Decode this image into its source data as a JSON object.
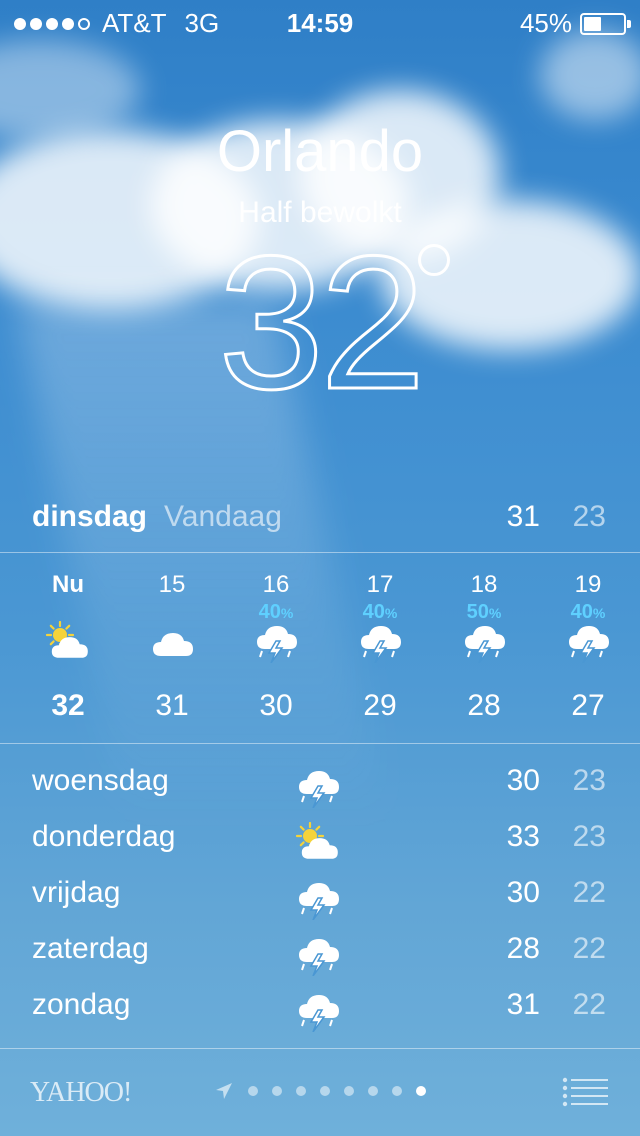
{
  "status_bar": {
    "carrier": "AT&T",
    "network": "3G",
    "time": "14:59",
    "battery": "45%",
    "battery_level": 0.45,
    "signal_bars": 4
  },
  "location": {
    "city": "Orlando",
    "condition": "Half bewolkt",
    "temperature": "32"
  },
  "today": {
    "day": "dinsdag",
    "label": "Vandaag",
    "high": "31",
    "low": "23"
  },
  "hourly": [
    {
      "time": "Nu",
      "pop": "",
      "icon": "sun-cloud-icon",
      "temp": "32"
    },
    {
      "time": "15",
      "pop": "",
      "icon": "cloud-icon",
      "temp": "31"
    },
    {
      "time": "16",
      "pop": "40",
      "icon": "thunderstorm-icon",
      "temp": "30"
    },
    {
      "time": "17",
      "pop": "40",
      "icon": "thunderstorm-icon",
      "temp": "29"
    },
    {
      "time": "18",
      "pop": "50",
      "icon": "thunderstorm-icon",
      "temp": "28"
    },
    {
      "time": "19",
      "pop": "40",
      "icon": "thunderstorm-icon",
      "temp": "27"
    }
  ],
  "daily": [
    {
      "day": "woensdag",
      "icon": "thunderstorm-icon",
      "high": "30",
      "low": "23"
    },
    {
      "day": "donderdag",
      "icon": "sun-cloud-icon",
      "high": "33",
      "low": "23"
    },
    {
      "day": "vrijdag",
      "icon": "thunderstorm-icon",
      "high": "30",
      "low": "22"
    },
    {
      "day": "zaterdag",
      "icon": "thunderstorm-icon",
      "high": "28",
      "low": "22"
    },
    {
      "day": "zondag",
      "icon": "thunderstorm-icon",
      "high": "31",
      "low": "22"
    }
  ],
  "footer": {
    "provider": "YAHOO!",
    "pages": 8,
    "active_page": 8
  },
  "colors": {
    "precipitation": "#5fd0ff",
    "sun": "#f5d33a"
  }
}
